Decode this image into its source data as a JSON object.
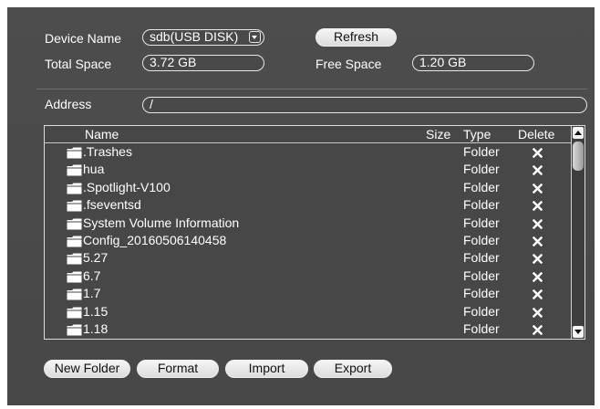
{
  "device": {
    "name_label": "Device Name",
    "name_value": "sdb(USB DISK)",
    "refresh_label": "Refresh",
    "total_label": "Total Space",
    "total_value": "3.72 GB",
    "free_label": "Free Space",
    "free_value": "1.20 GB"
  },
  "address": {
    "label": "Address",
    "value": "/"
  },
  "table": {
    "headers": {
      "name": "Name",
      "size": "Size",
      "type": "Type",
      "delete": "Delete"
    },
    "rows": [
      {
        "name": ".Trashes",
        "type": "Folder"
      },
      {
        "name": "hua",
        "type": "Folder"
      },
      {
        "name": ".Spotlight-V100",
        "type": "Folder"
      },
      {
        "name": ".fseventsd",
        "type": "Folder"
      },
      {
        "name": "System Volume Information",
        "type": "Folder"
      },
      {
        "name": "Config_20160506140458",
        "type": "Folder"
      },
      {
        "name": "5.27",
        "type": "Folder"
      },
      {
        "name": "6.7",
        "type": "Folder"
      },
      {
        "name": "1.7",
        "type": "Folder"
      },
      {
        "name": "1.15",
        "type": "Folder"
      },
      {
        "name": "1.18",
        "type": "Folder"
      }
    ],
    "row_icon": "folder-icon",
    "delete_icon": "close-icon"
  },
  "actions": {
    "new_folder": "New Folder",
    "format": "Format",
    "import": "Import",
    "export": "Export"
  },
  "colors": {
    "panel_bg": "#4a4a4a",
    "button_bg": "#e8e8e8",
    "text": "#ffffff"
  }
}
